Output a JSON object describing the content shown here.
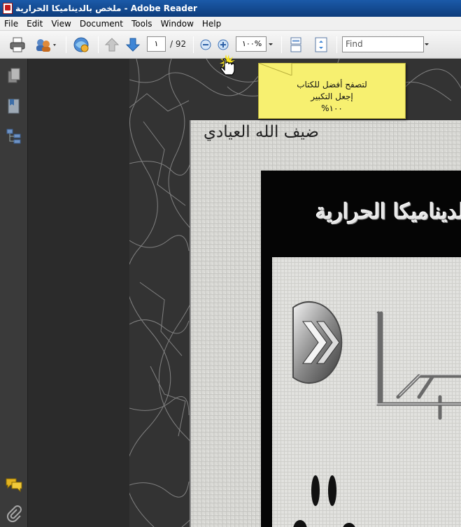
{
  "window": {
    "title": "ملخص بالديناميكا الحرارية - Adobe Reader"
  },
  "menu": {
    "items": [
      "File",
      "Edit",
      "View",
      "Document",
      "Tools",
      "Window",
      "Help"
    ]
  },
  "toolbar": {
    "page_current": "١",
    "page_total": "/ 92",
    "zoom_value": "١٠٠%",
    "find_placeholder": "Find",
    "icons": [
      "print-icon",
      "collaborate-icon",
      "share-icon",
      "previous-page-icon",
      "next-page-icon",
      "zoom-out-icon",
      "zoom-in-icon",
      "scrolling-mode-icon",
      "fit-page-icon"
    ]
  },
  "navpane": {
    "icons": [
      "pages-icon",
      "bookmarks-icon",
      "model-tree-icon",
      "comments-icon",
      "attachments-icon"
    ]
  },
  "tooltip": {
    "line1": "لتصفح أفضل للكتاب",
    "line2": "إجعل التكبير",
    "line3": "١٠٠%"
  },
  "document": {
    "author": "ضيف الله العيادي",
    "cover_title": "الديناميكا الحرارية"
  },
  "colors": {
    "titlebar": "#1b5aa9",
    "tooltip": "#f7f070",
    "workspace": "#2b2b2b"
  }
}
